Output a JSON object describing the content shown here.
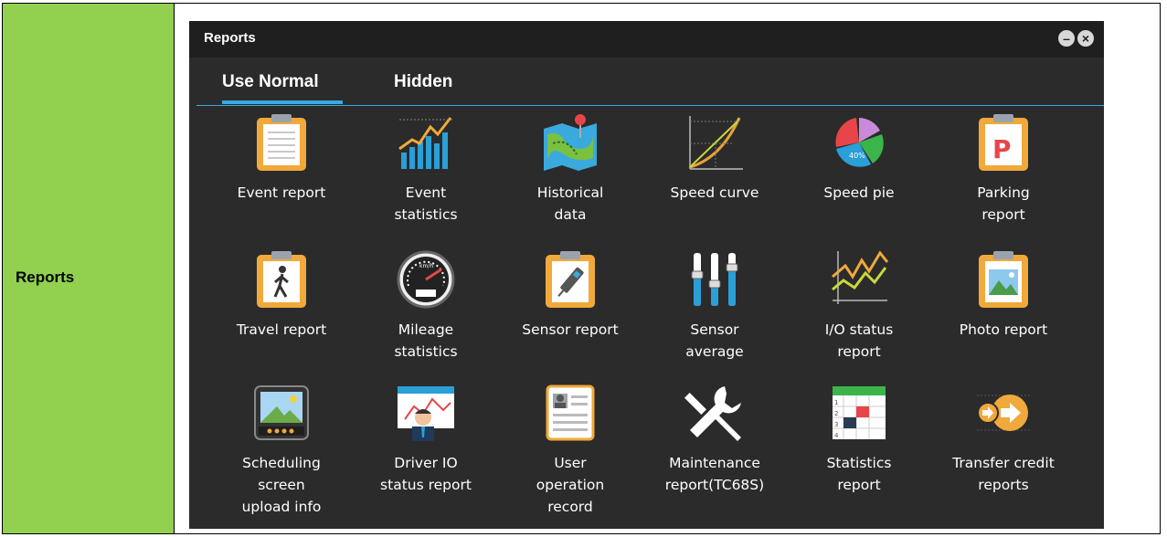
{
  "side_label": "Reports",
  "window": {
    "title": "Reports"
  },
  "tabs": [
    {
      "label": "Use Normal"
    },
    {
      "label": "Hidden"
    }
  ],
  "items": [
    {
      "label": "Event report",
      "icon": "clipboard-icon"
    },
    {
      "label": "Event statistics",
      "icon": "bar-chart-icon"
    },
    {
      "label": "Historical data",
      "icon": "map-pin-icon"
    },
    {
      "label": "Speed curve",
      "icon": "curve-graph-icon"
    },
    {
      "label": "Speed pie",
      "icon": "pie-chart-icon"
    },
    {
      "label": "Parking report",
      "icon": "parking-clipboard-icon"
    },
    {
      "label": "Travel report",
      "icon": "walking-clipboard-icon"
    },
    {
      "label": "Mileage statistics",
      "icon": "speedometer-icon"
    },
    {
      "label": "Sensor report",
      "icon": "sensor-clipboard-icon"
    },
    {
      "label": "Sensor average",
      "icon": "sliders-icon"
    },
    {
      "label": "I/O status report",
      "icon": "line-graph-icon"
    },
    {
      "label": "Photo report",
      "icon": "photo-clipboard-icon"
    },
    {
      "label": "Scheduling screen upload info",
      "icon": "screen-icon"
    },
    {
      "label": "Driver IO status report",
      "icon": "driver-chart-icon"
    },
    {
      "label": "User operation record",
      "icon": "id-card-icon"
    },
    {
      "label": "Maintenance report(TC68S)",
      "icon": "wrench-screwdriver-icon"
    },
    {
      "label": "Statistics report",
      "icon": "calendar-table-icon"
    },
    {
      "label": "Transfer credit reports",
      "icon": "transfer-icon"
    }
  ]
}
